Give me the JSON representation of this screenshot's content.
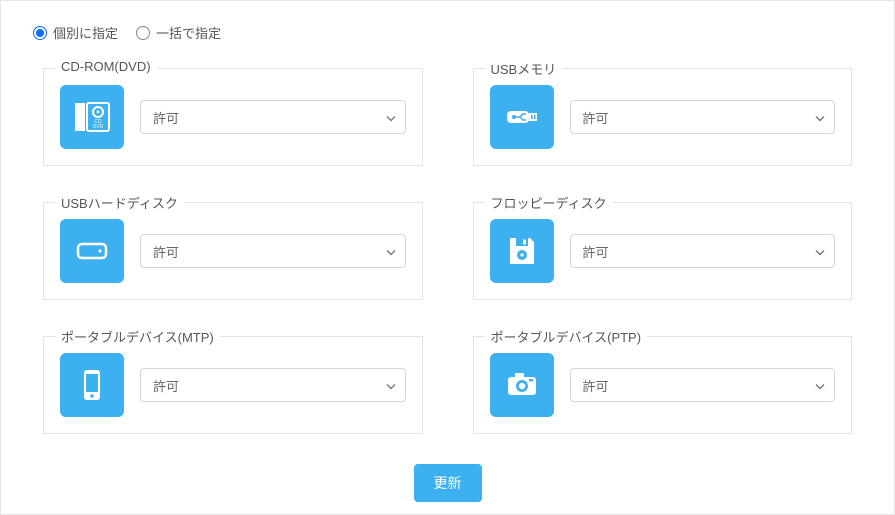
{
  "mode": {
    "individual": "個別に指定",
    "batch": "一括で指定",
    "selected": "individual"
  },
  "devices": {
    "cdrom": {
      "label": "CD-ROM(DVD)",
      "value": "許可"
    },
    "usbmem": {
      "label": "USBメモリ",
      "value": "許可"
    },
    "usbhdd": {
      "label": "USBハードディスク",
      "value": "許可"
    },
    "floppy": {
      "label": "フロッピーディスク",
      "value": "許可"
    },
    "mtp": {
      "label": "ポータブルデバイス(MTP)",
      "value": "許可"
    },
    "ptp": {
      "label": "ポータブルデバイス(PTP)",
      "value": "許可"
    }
  },
  "buttons": {
    "update": "更新"
  },
  "colors": {
    "accent": "#3db0ef",
    "radio": "#0d6efd"
  }
}
